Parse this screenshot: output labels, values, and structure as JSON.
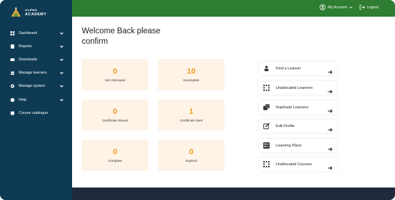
{
  "brand": {
    "line1": "ALPHA",
    "line2": "ACADEMY"
  },
  "sidebar": {
    "items": [
      {
        "label": "Dashboard",
        "icon": "grid-icon",
        "has_chevron": true
      },
      {
        "label": "Reports",
        "icon": "report-icon",
        "has_chevron": true
      },
      {
        "label": "Downloads",
        "icon": "download-icon",
        "has_chevron": true
      },
      {
        "label": "Manage learners",
        "icon": "users-icon",
        "has_chevron": true
      },
      {
        "label": "Manage system",
        "icon": "gear-icon",
        "has_chevron": true
      },
      {
        "label": "Help",
        "icon": "help-icon",
        "has_chevron": true
      },
      {
        "label": "Course catalogue",
        "icon": "book-icon",
        "has_chevron": false
      }
    ]
  },
  "topbar": {
    "account_label": "My Account",
    "logout_label": "Logout"
  },
  "main": {
    "welcome": "Welcome Back please confirm",
    "stats": [
      {
        "value": "0",
        "label": "Not Attemped"
      },
      {
        "value": "10",
        "label": "Incomplete"
      },
      {
        "value": "0",
        "label": "Certificate Issued"
      },
      {
        "value": "1",
        "label": "Certificate Sent"
      },
      {
        "value": "0",
        "label": "Complete"
      },
      {
        "value": "0",
        "label": "Expired"
      }
    ],
    "actions": [
      {
        "label": "Find a Learner",
        "icon": "person-icon"
      },
      {
        "label": "Unallocated Learners",
        "icon": "dots-grid-icon"
      },
      {
        "label": "Duplicate Learners",
        "icon": "duplicate-icon"
      },
      {
        "label": "Edit Profile",
        "icon": "edit-icon"
      },
      {
        "label": "Learning Plans",
        "icon": "plan-icon"
      },
      {
        "label": "Unallocated Courses",
        "icon": "dots-grid-icon"
      }
    ]
  },
  "colors": {
    "sidebar_bg": "#0e3a54",
    "topbar_bg": "#2f7d32",
    "stat_card_bg": "#fdf3e6",
    "stat_value": "#f29c1f",
    "footer_bg": "#1f2a3d"
  }
}
